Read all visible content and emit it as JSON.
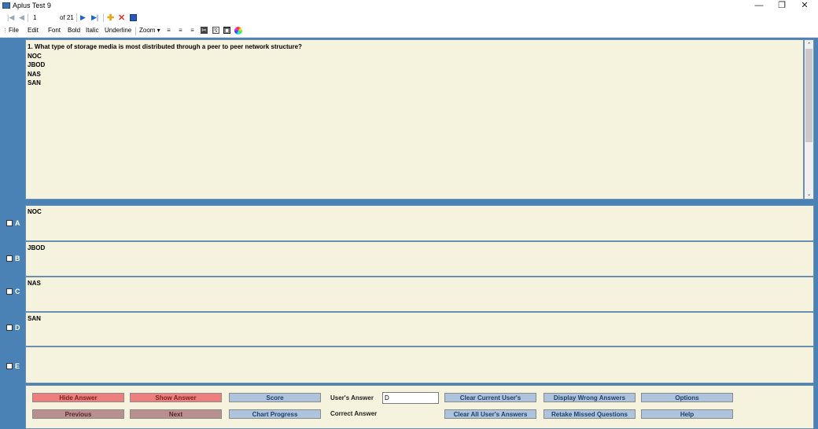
{
  "window": {
    "title": "Aplus Test 9",
    "controls": {
      "minimize": "—",
      "restore": "❐",
      "close": "✕"
    }
  },
  "navigator": {
    "position": "1",
    "of_label": "of 21"
  },
  "menu": {
    "items": [
      "File",
      "Edit",
      "Font",
      "Bold",
      "Italic",
      "Underline",
      "Zoom ▾"
    ]
  },
  "question": {
    "text": "1. What type of storage media is most distributed through a peer to peer network structure?",
    "choices": [
      "NOC",
      "JBOD",
      "NAS",
      "SAN"
    ]
  },
  "answers": [
    {
      "letter": "A",
      "text": "NOC"
    },
    {
      "letter": "B",
      "text": "JBOD"
    },
    {
      "letter": "C",
      "text": "NAS"
    },
    {
      "letter": "D",
      "text": "SAN"
    },
    {
      "letter": "E",
      "text": ""
    }
  ],
  "buttons": {
    "hide_answer": "Hide Answer",
    "show_answer": "Show Answer",
    "score": "Score",
    "previous": "Previous",
    "next": "Next",
    "chart_progress": "Chart Progress",
    "clear_current": "Clear Current User's",
    "clear_all": "Clear All User's Answers",
    "display_wrong": "Display Wrong Answers",
    "retake_missed": "Retake Missed Questions",
    "options": "Options",
    "help": "Help"
  },
  "labels": {
    "users_answer": "User's Answer",
    "correct_answer": "Correct Answer"
  },
  "inputs": {
    "users_answer_value": "D"
  },
  "colors": {
    "background": "#4a82b6",
    "panel": "#f5f3dd",
    "red_button": "#ef7f7f",
    "brown_button": "#b99090",
    "blue_button": "#aec4dc"
  }
}
